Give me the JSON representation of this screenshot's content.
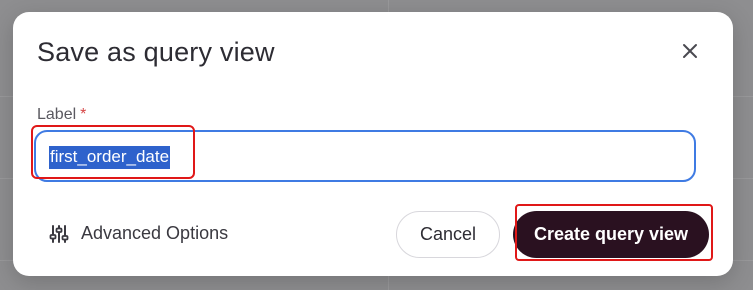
{
  "dialog": {
    "title": "Save as query view",
    "close_icon": "close-icon"
  },
  "label_field": {
    "label": "Label",
    "required_marker": "*",
    "value": "first_order_date"
  },
  "footer": {
    "advanced_options_label": "Advanced Options",
    "advanced_options_icon": "sliders-icon",
    "cancel_label": "Cancel",
    "create_label": "Create query view"
  },
  "colors": {
    "primary_button": "#2a1120",
    "focus_border": "#3f7be3",
    "selection": "#2e62cc",
    "annotation": "#e01818",
    "required": "#d64545"
  }
}
